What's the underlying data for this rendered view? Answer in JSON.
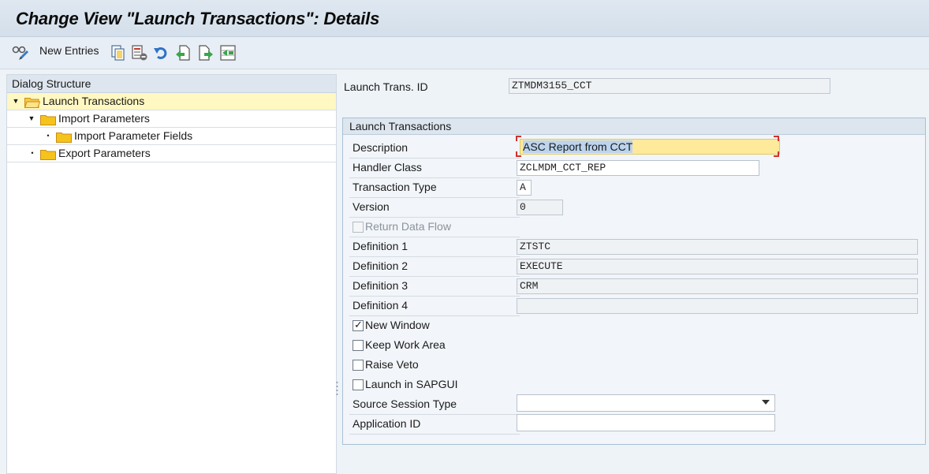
{
  "title": "Change View \"Launch Transactions\": Details",
  "toolbar": {
    "new_entries_label": "New Entries",
    "icons": [
      "glasses-pencil-icon",
      "copy-icon",
      "delete-icon",
      "undo-icon",
      "previous-entry-icon",
      "next-entry-icon",
      "select-block-icon"
    ]
  },
  "dialog_structure": {
    "header": "Dialog Structure",
    "items": [
      {
        "label": "Launch Transactions",
        "level": 0,
        "expanded": true,
        "selected": true
      },
      {
        "label": "Import Parameters",
        "level": 1,
        "expanded": true,
        "selected": false
      },
      {
        "label": "Import Parameter Fields",
        "level": 2,
        "expanded": false,
        "selected": false
      },
      {
        "label": "Export Parameters",
        "level": 1,
        "expanded": false,
        "selected": false
      }
    ]
  },
  "launch_trans_id": {
    "label": "Launch Trans. ID",
    "value": "ZTMDM3155_CCT"
  },
  "group": {
    "title": "Launch Transactions",
    "fields": {
      "description": {
        "label": "Description",
        "value": "ASC Report from CCT"
      },
      "handler_class": {
        "label": "Handler Class",
        "value": "ZCLMDM_CCT_REP"
      },
      "transaction_type": {
        "label": "Transaction Type",
        "value": "A"
      },
      "version": {
        "label": "Version",
        "value": "0"
      },
      "return_data_flow": {
        "label": "Return Data Flow",
        "checked": false,
        "disabled": true
      },
      "definition1": {
        "label": "Definition 1",
        "value": "ZTSTC"
      },
      "definition2": {
        "label": "Definition 2",
        "value": "EXECUTE"
      },
      "definition3": {
        "label": "Definition 3",
        "value": "CRM"
      },
      "definition4": {
        "label": "Definition 4",
        "value": ""
      },
      "new_window": {
        "label": "New Window",
        "checked": true
      },
      "keep_work_area": {
        "label": "Keep Work Area",
        "checked": false
      },
      "raise_veto": {
        "label": "Raise Veto",
        "checked": false
      },
      "launch_in_sapgui": {
        "label": "Launch in SAPGUI",
        "checked": false
      },
      "source_session_type": {
        "label": "Source Session Type",
        "value": ""
      },
      "application_id": {
        "label": "Application ID",
        "value": ""
      }
    }
  },
  "colors": {
    "folder": "#f5c31b",
    "selected_row": "#fff8c2",
    "focused_field": "#ffe99a",
    "focus_corner": "#d0342c"
  }
}
